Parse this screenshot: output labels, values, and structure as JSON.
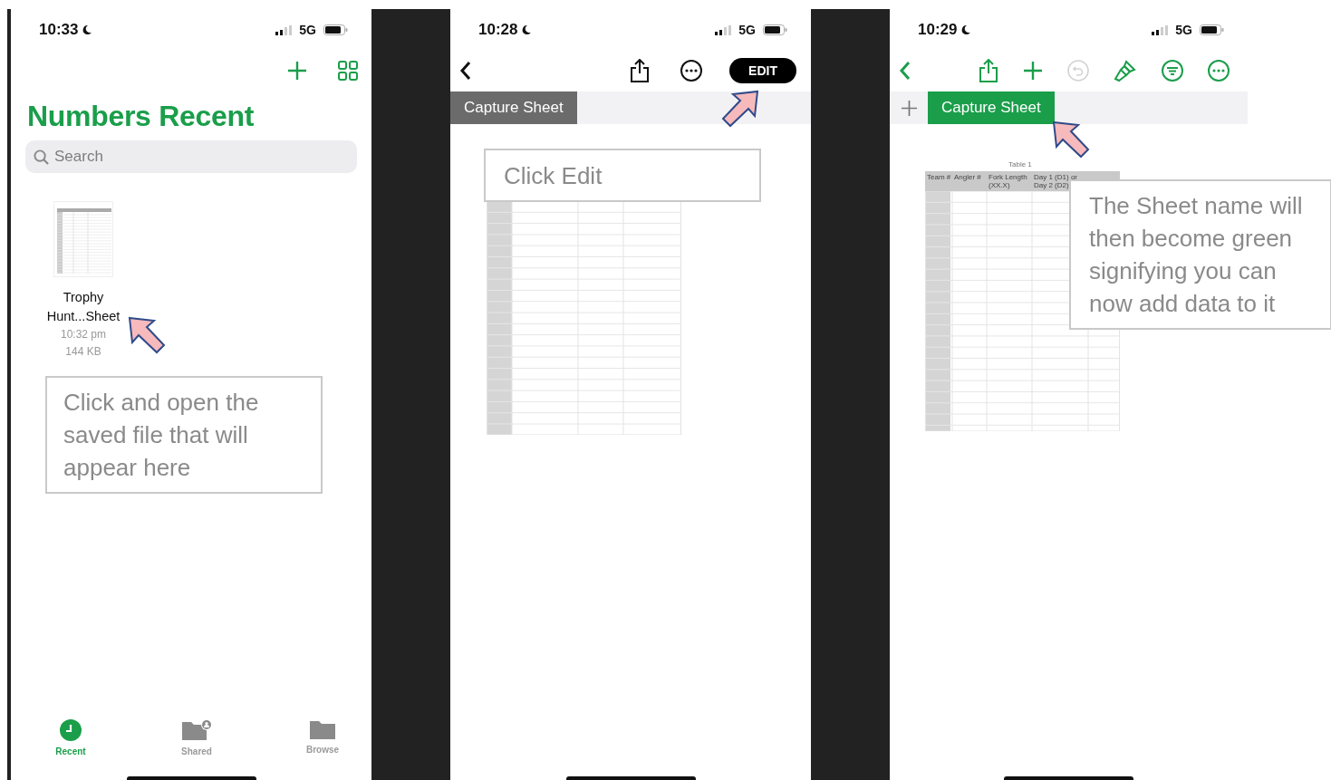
{
  "screens": [
    {
      "kind": "recent",
      "status_bar": {
        "time": "10:33",
        "network": "5G"
      },
      "title": "Numbers Recent",
      "search": {
        "placeholder": "Search"
      },
      "files": [
        {
          "name": "Trophy Hunt...Sheet",
          "time": "10:32 pm",
          "size": "144 KB"
        }
      ],
      "tab_bar": [
        {
          "label": "Recent",
          "selected": true
        },
        {
          "label": "Shared",
          "selected": false
        },
        {
          "label": "Browse",
          "selected": false
        }
      ],
      "note": "Click and open the saved file that will appear here"
    },
    {
      "kind": "sheet",
      "status_bar": {
        "time": "10:28",
        "network": "5G"
      },
      "edit_mode": false,
      "edit_button": "EDIT",
      "sheet_tab": {
        "label": "Capture Sheet"
      },
      "note": "Click Edit"
    },
    {
      "kind": "sheet",
      "status_bar": {
        "time": "10:29",
        "network": "5G"
      },
      "edit_mode": true,
      "sheet_tab": {
        "label": "Capture Sheet"
      },
      "table": {
        "title": "Table 1",
        "columns": [
          "Team #",
          "Angler #",
          "Fork Length (XX.X)",
          "Day 1 (D1) or Day 2 (D2)"
        ]
      },
      "note": "The Sheet name will then become green signifying you can now add data to it"
    }
  ]
}
